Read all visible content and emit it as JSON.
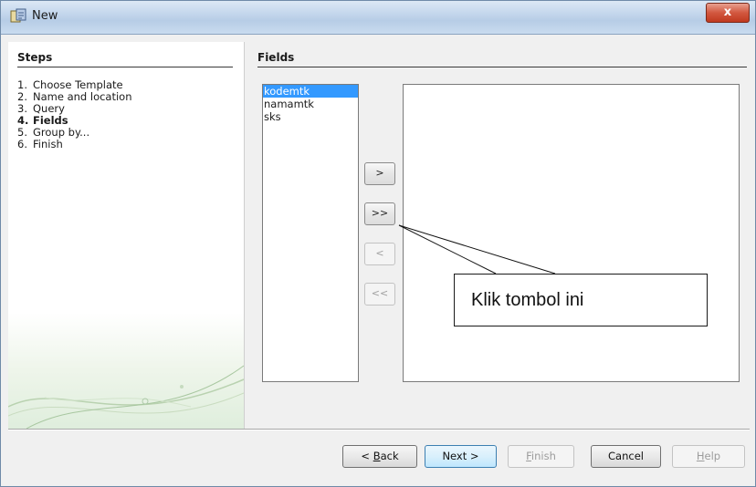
{
  "window": {
    "title": "New",
    "close_label": "x"
  },
  "steps": {
    "title": "Steps",
    "items": [
      {
        "num": "1.",
        "label": "Choose Template"
      },
      {
        "num": "2.",
        "label": "Name and location"
      },
      {
        "num": "3.",
        "label": "Query"
      },
      {
        "num": "4.",
        "label": "Fields"
      },
      {
        "num": "5.",
        "label": "Group by..."
      },
      {
        "num": "6.",
        "label": "Finish"
      }
    ],
    "active_index": 3
  },
  "fields": {
    "title": "Fields",
    "available": [
      "kodemtk",
      "namamtk",
      "sks"
    ],
    "available_selected": "kodemtk",
    "selected": []
  },
  "move_buttons": {
    "add_one": ">",
    "add_all": ">>",
    "remove_one": "<",
    "remove_all": "<<"
  },
  "footer": {
    "back": {
      "prefix": "< ",
      "mnemonic": "B",
      "rest": "ack"
    },
    "next": "Next >",
    "finish": {
      "mnemonic": "F",
      "rest": "inish"
    },
    "cancel": "Cancel",
    "help": {
      "mnemonic": "H",
      "rest": "elp"
    }
  },
  "annotation": {
    "text": "Klik tombol ini"
  },
  "colors": {
    "selection": "#3399ff",
    "title_bar": "#c3d6ec",
    "close": "#c0391f"
  }
}
